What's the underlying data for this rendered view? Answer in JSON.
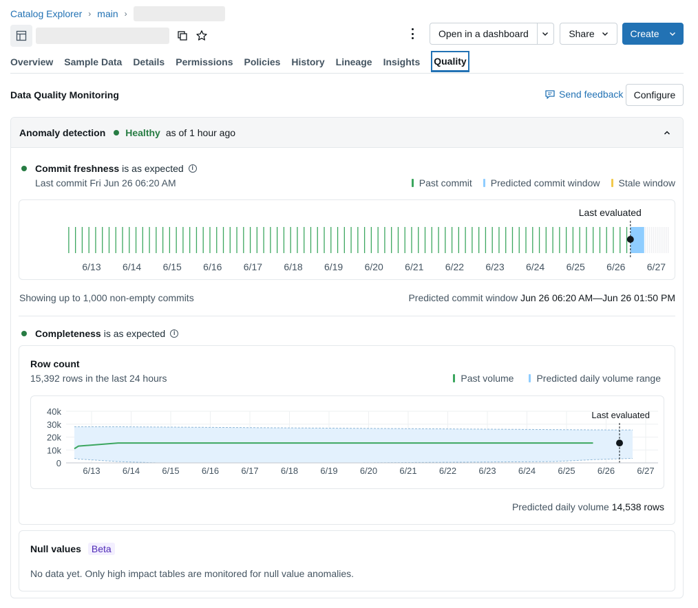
{
  "breadcrumb": {
    "root": "Catalog Explorer",
    "catalog": "main"
  },
  "header": {
    "open_dashboard_label": "Open in a dashboard",
    "share_label": "Share",
    "create_label": "Create"
  },
  "tabs": [
    "Overview",
    "Sample Data",
    "Details",
    "Permissions",
    "Policies",
    "History",
    "Lineage",
    "Insights",
    "Quality"
  ],
  "active_tab": "Quality",
  "dqm": {
    "title": "Data Quality Monitoring",
    "feedback_label": "Send feedback",
    "configure_label": "Configure"
  },
  "anomaly": {
    "title": "Anomaly detection",
    "status": "Healthy",
    "as_of": "as of 1 hour ago"
  },
  "freshness": {
    "title": "Commit freshness",
    "status_text": "is as expected",
    "last_commit": "Last commit Fri Jun 26 06:20 AM",
    "legend": [
      {
        "label": "Past commit",
        "color": "#3ba65e"
      },
      {
        "label": "Predicted commit window",
        "color": "#8fcdff"
      },
      {
        "label": "Stale window",
        "color": "#f2c94c"
      }
    ],
    "last_evaluated": "Last evaluated",
    "footer_left": "Showing up to 1,000 non-empty commits",
    "footer_right_label": "Predicted commit window",
    "footer_right_value": "Jun 26 06:20 AM—Jun 26 01:50 PM"
  },
  "completeness": {
    "title": "Completeness",
    "status_text": "is as expected",
    "row_count_title": "Row count",
    "row_count_sub": "15,392 rows in the last 24 hours",
    "legend": [
      {
        "label": "Past volume",
        "color": "#3ba65e"
      },
      {
        "label": "Predicted daily volume range",
        "color": "#8fcdff"
      }
    ],
    "last_evaluated": "Last evaluated",
    "footer_label": "Predicted daily volume",
    "footer_value": "14,538 rows"
  },
  "nulls": {
    "title": "Null values",
    "badge": "Beta",
    "message": "No data yet. Only high impact tables are monitored for null value anomalies."
  },
  "chart_data": [
    {
      "type": "bar",
      "title": "Commit freshness",
      "x_ticks": [
        "6/13",
        "6/14",
        "6/15",
        "6/16",
        "6/17",
        "6/18",
        "6/19",
        "6/20",
        "6/21",
        "6/22",
        "6/23",
        "6/24",
        "6/25",
        "6/26",
        "6/27"
      ],
      "commits_per_day": [
        6,
        6,
        6,
        6,
        6,
        6,
        6,
        6,
        6,
        6,
        6,
        6,
        6,
        6,
        2
      ],
      "predicted_window": [
        "Jun 26 06:20 AM",
        "Jun 26 01:50 PM"
      ],
      "last_evaluated_marker": "6/26"
    },
    {
      "type": "line",
      "title": "Row count",
      "x": [
        "6/12",
        "6/13",
        "6/14",
        "6/15",
        "6/16",
        "6/17",
        "6/18",
        "6/19",
        "6/20",
        "6/21",
        "6/22",
        "6/23",
        "6/24",
        "6/25",
        "6/26",
        "6/27"
      ],
      "series": [
        {
          "name": "Past volume",
          "values": [
            11000,
            13000,
            15400,
            15400,
            15400,
            15400,
            15400,
            15400,
            15400,
            15400,
            15400,
            15400,
            15400,
            15400,
            15400,
            null
          ]
        },
        {
          "name": "Predicted daily volume range",
          "upper": [
            28000,
            28000,
            28000,
            27800,
            27600,
            27400,
            27200,
            27000,
            26800,
            26600,
            26400,
            26200,
            26000,
            25800,
            25600,
            25500
          ],
          "lower": [
            3500,
            3000,
            1000,
            -1000,
            -800,
            -600,
            -400,
            -200,
            0,
            200,
            400,
            600,
            800,
            1000,
            2500,
            3500
          ]
        }
      ],
      "y_ticks": [
        "0",
        "10k",
        "20k",
        "30k",
        "40k"
      ],
      "ylim": [
        0,
        40000
      ],
      "x_ticks": [
        "6/13",
        "6/14",
        "6/15",
        "6/16",
        "6/17",
        "6/18",
        "6/19",
        "6/20",
        "6/21",
        "6/22",
        "6/23",
        "6/24",
        "6/25",
        "6/26",
        "6/27"
      ],
      "last_evaluated_marker": "6/26"
    }
  ]
}
